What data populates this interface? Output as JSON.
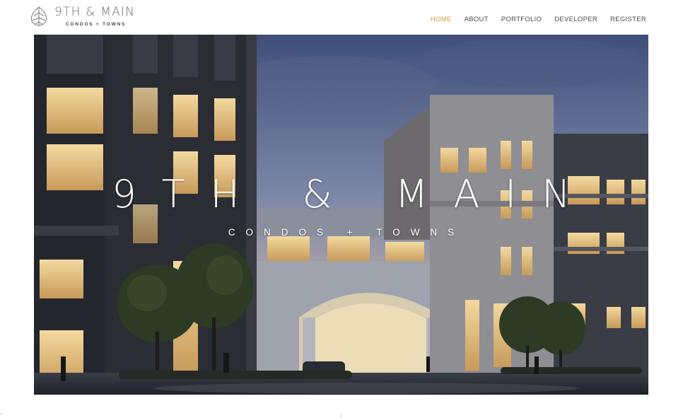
{
  "logo": {
    "title": "9TH & MAIN",
    "subtitle": "CONDOS + TOWNS",
    "icon": "leaf-icon"
  },
  "nav": {
    "items": [
      {
        "label": "HOME",
        "active": true
      },
      {
        "label": "ABOUT",
        "active": false
      },
      {
        "label": "PORTFOLIO",
        "active": false
      },
      {
        "label": "DEVELOPER",
        "active": false
      },
      {
        "label": "REGISTER",
        "active": false
      }
    ],
    "active_color": "#d79a3a",
    "text_color": "#4a4a4a"
  },
  "hero": {
    "title": "9TH & MAIN",
    "subtitle": "CONDOS + TOWNS",
    "image": "building-rendering-dusk"
  }
}
